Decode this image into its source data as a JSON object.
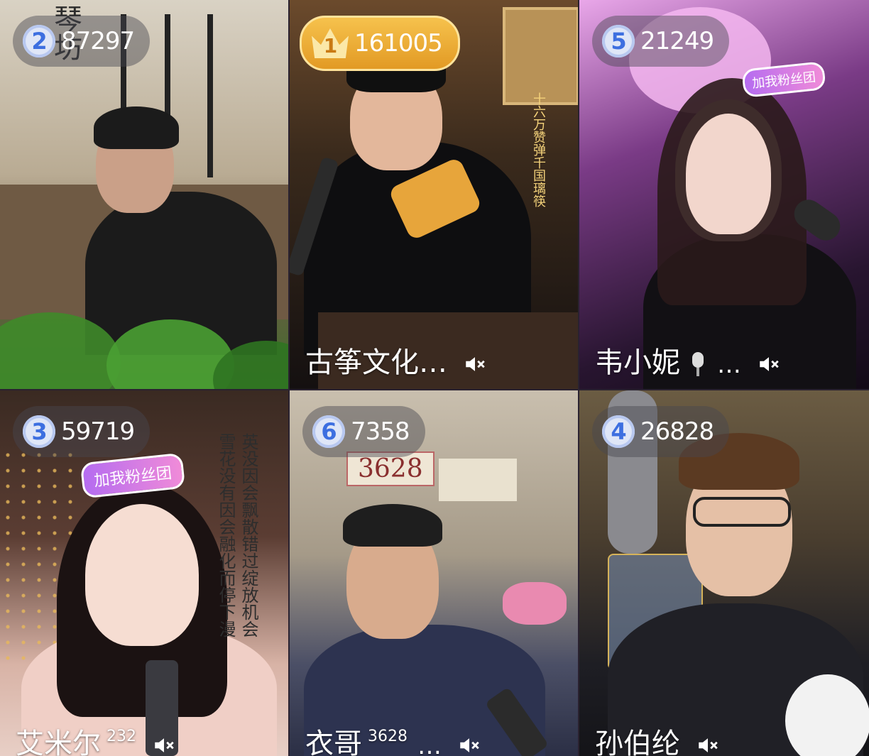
{
  "tiles": [
    {
      "rank": "2",
      "score": "87297",
      "name": "",
      "sup": "",
      "muted": false
    },
    {
      "rank": "1",
      "score": "161005",
      "name": "古筝文化…",
      "sup": "",
      "muted": true
    },
    {
      "rank": "5",
      "score": "21249",
      "name": "韦小妮",
      "sup": "",
      "suffix": "…",
      "mic_icon": "microphone-icon",
      "muted": true
    },
    {
      "rank": "3",
      "score": "59719",
      "name": "艾米尔",
      "sup": "232",
      "muted": true,
      "sticker": "加我粉丝团",
      "lyrics": [
        "英没因会飘散错过绽放机会",
        "雪花没有因会融化而停下漫"
      ]
    },
    {
      "rank": "6",
      "score": "7358",
      "name": "衣哥",
      "sup": "3628",
      "suffix": "…",
      "muted": true,
      "sign_text": "3628"
    },
    {
      "rank": "4",
      "score": "26828",
      "name": "孙伯纶",
      "sup": "",
      "muted": true
    }
  ],
  "tile3_sticker": "加我粉丝团",
  "tile1_calligraphy": "琴坊",
  "tile2_side_text": "十六万赞弹千国璃筷",
  "icons": {
    "mute": "speaker-muted-icon",
    "crown": "crown-icon"
  }
}
